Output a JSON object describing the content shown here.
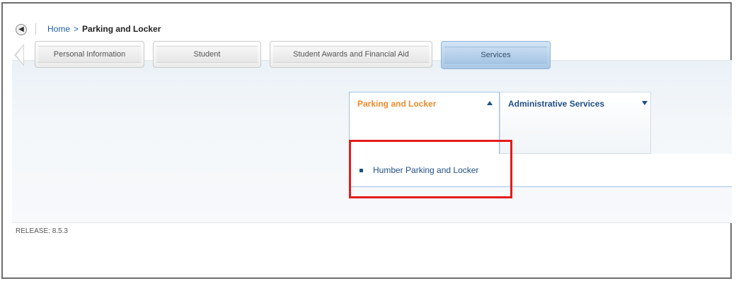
{
  "breadcrumb": {
    "home": "Home",
    "separator": ">",
    "current": "Parking and Locker"
  },
  "tabs": [
    {
      "label": "Personal Information",
      "active": false
    },
    {
      "label": "Student",
      "active": false
    },
    {
      "label": "Student Awards and Financial Aid",
      "active": false
    },
    {
      "label": "Services",
      "active": true
    }
  ],
  "menus": {
    "open": {
      "title": "Parking and Locker",
      "caret": "up"
    },
    "closed": {
      "title": "Administrative Services",
      "caret": "down"
    }
  },
  "dropdown": {
    "items": [
      {
        "label": "Humber Parking and Locker"
      }
    ]
  },
  "footer": {
    "release": "RELEASE: 8.5.3"
  },
  "colors": {
    "link": "#1f5fa8",
    "menu_open_title": "#f08a2c",
    "menu_title": "#1f4f86",
    "highlight": "#e31b1b",
    "active_tab": "#a9c8e6"
  },
  "icons": {
    "back": "back-arrow-icon",
    "open_caret": "caret-up-icon",
    "closed_caret": "caret-down-icon",
    "item_bullet": "bullet-icon"
  }
}
